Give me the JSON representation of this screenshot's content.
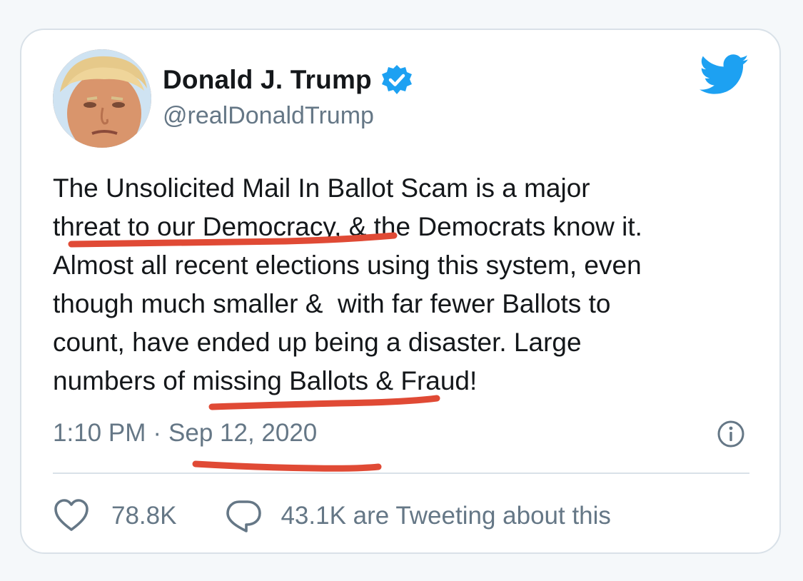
{
  "tweet": {
    "author_name": "Donald J. Trump",
    "handle": "@realDonaldTrump",
    "verified": true,
    "avatar_icon": "profile-photo",
    "brand_icon": "twitter-bird-icon",
    "text": "The Unsolicited Mail In Ballot Scam is a major\nthreat to our Democracy, & the Democrats know it.\nAlmost all recent elections using this system, even\nthough much smaller &  with far fewer Ballots to\ncount, have ended up being a disaster. Large\nnumbers of missing Ballots & Fraud!",
    "time": "1:10 PM",
    "separator": "·",
    "date": "Sep 12, 2020",
    "likes": "78.8K",
    "tweeting_about": "43.1K are Tweeting about this"
  },
  "colors": {
    "brand_blue": "#1da1f2",
    "text": "#14171a",
    "muted": "#657786",
    "annotation_red": "#e04a35"
  }
}
